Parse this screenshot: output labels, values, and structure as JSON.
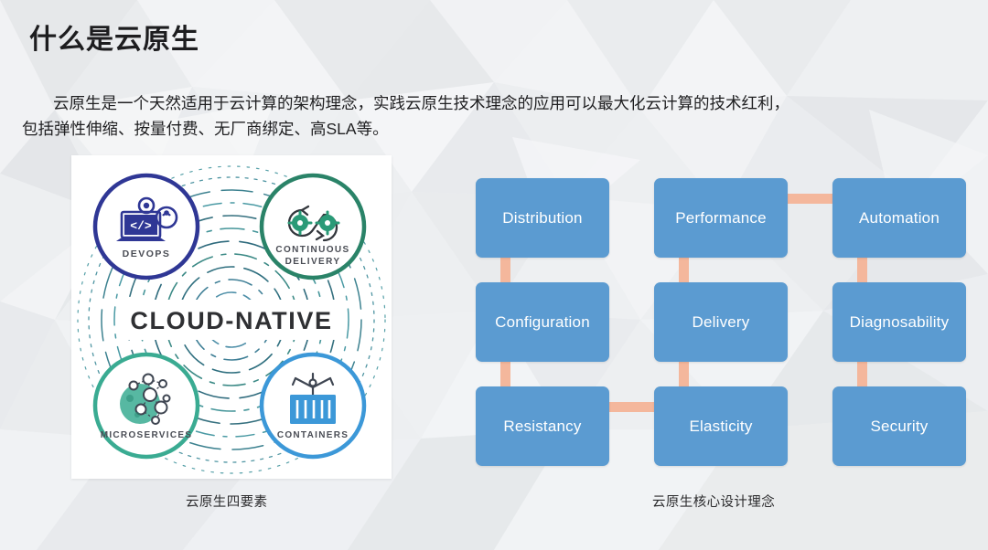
{
  "slide": {
    "title": "什么是云原生",
    "body_line1": "云原生是一个天然适用于云计算的架构理念，实践云原生技术理念的应用可以最大化云计算的技术红利，",
    "body_line2": "包括弹性伸缩、按量付费、无厂商绑定、高SLA等。",
    "background_color": "#eceef0"
  },
  "left_figure": {
    "caption": "云原生四要素",
    "center_label": "CLOUD-NATIVE",
    "panel_color": "#ffffff",
    "nodes": [
      {
        "label": "DEVOPS",
        "icon": "laptop-code-icon",
        "ring_color": "#2f3795",
        "position": "top-left"
      },
      {
        "label": "CONTINUOUS DELIVERY",
        "icon": "infinity-gears-icon",
        "ring_color": "#2a8368",
        "position": "top-right"
      },
      {
        "label": "MICROSERVICES",
        "icon": "node-network-icon",
        "ring_color": "#3aab92",
        "position": "bottom-left"
      },
      {
        "label": "CONTAINERS",
        "icon": "shipping-container-icon",
        "ring_color": "#3c98d8",
        "position": "bottom-right"
      }
    ]
  },
  "right_figure": {
    "caption": "云原生核心设计理念",
    "box_color": "#5b9bd1",
    "connector_color": "#f4b79c",
    "text_color": "#ffffff",
    "grid": [
      [
        "Distribution",
        "Performance",
        "Automation"
      ],
      [
        "Configuration",
        "Delivery",
        "Diagnosability"
      ],
      [
        "Resistancy",
        "Elasticity",
        "Security"
      ]
    ],
    "boxes": [
      {
        "label": "Distribution",
        "row": 0,
        "col": 0
      },
      {
        "label": "Performance",
        "row": 0,
        "col": 1
      },
      {
        "label": "Automation",
        "row": 0,
        "col": 2
      },
      {
        "label": "Configuration",
        "row": 1,
        "col": 0
      },
      {
        "label": "Delivery",
        "row": 1,
        "col": 1
      },
      {
        "label": "Diagnosability",
        "row": 1,
        "col": 2
      },
      {
        "label": "Resistancy",
        "row": 2,
        "col": 0
      },
      {
        "label": "Elasticity",
        "row": 2,
        "col": 1
      },
      {
        "label": "Security",
        "row": 2,
        "col": 2
      }
    ],
    "connectors": [
      {
        "from": "Distribution",
        "to": "Configuration",
        "orientation": "vertical"
      },
      {
        "from": "Configuration",
        "to": "Resistancy",
        "orientation": "vertical"
      },
      {
        "from": "Performance",
        "to": "Delivery",
        "orientation": "vertical"
      },
      {
        "from": "Delivery",
        "to": "Elasticity",
        "orientation": "vertical"
      },
      {
        "from": "Automation",
        "to": "Diagnosability",
        "orientation": "vertical"
      },
      {
        "from": "Diagnosability",
        "to": "Security",
        "orientation": "vertical"
      },
      {
        "from": "Performance",
        "to": "Automation",
        "orientation": "horizontal"
      },
      {
        "from": "Resistancy",
        "to": "Elasticity",
        "orientation": "horizontal"
      }
    ]
  }
}
